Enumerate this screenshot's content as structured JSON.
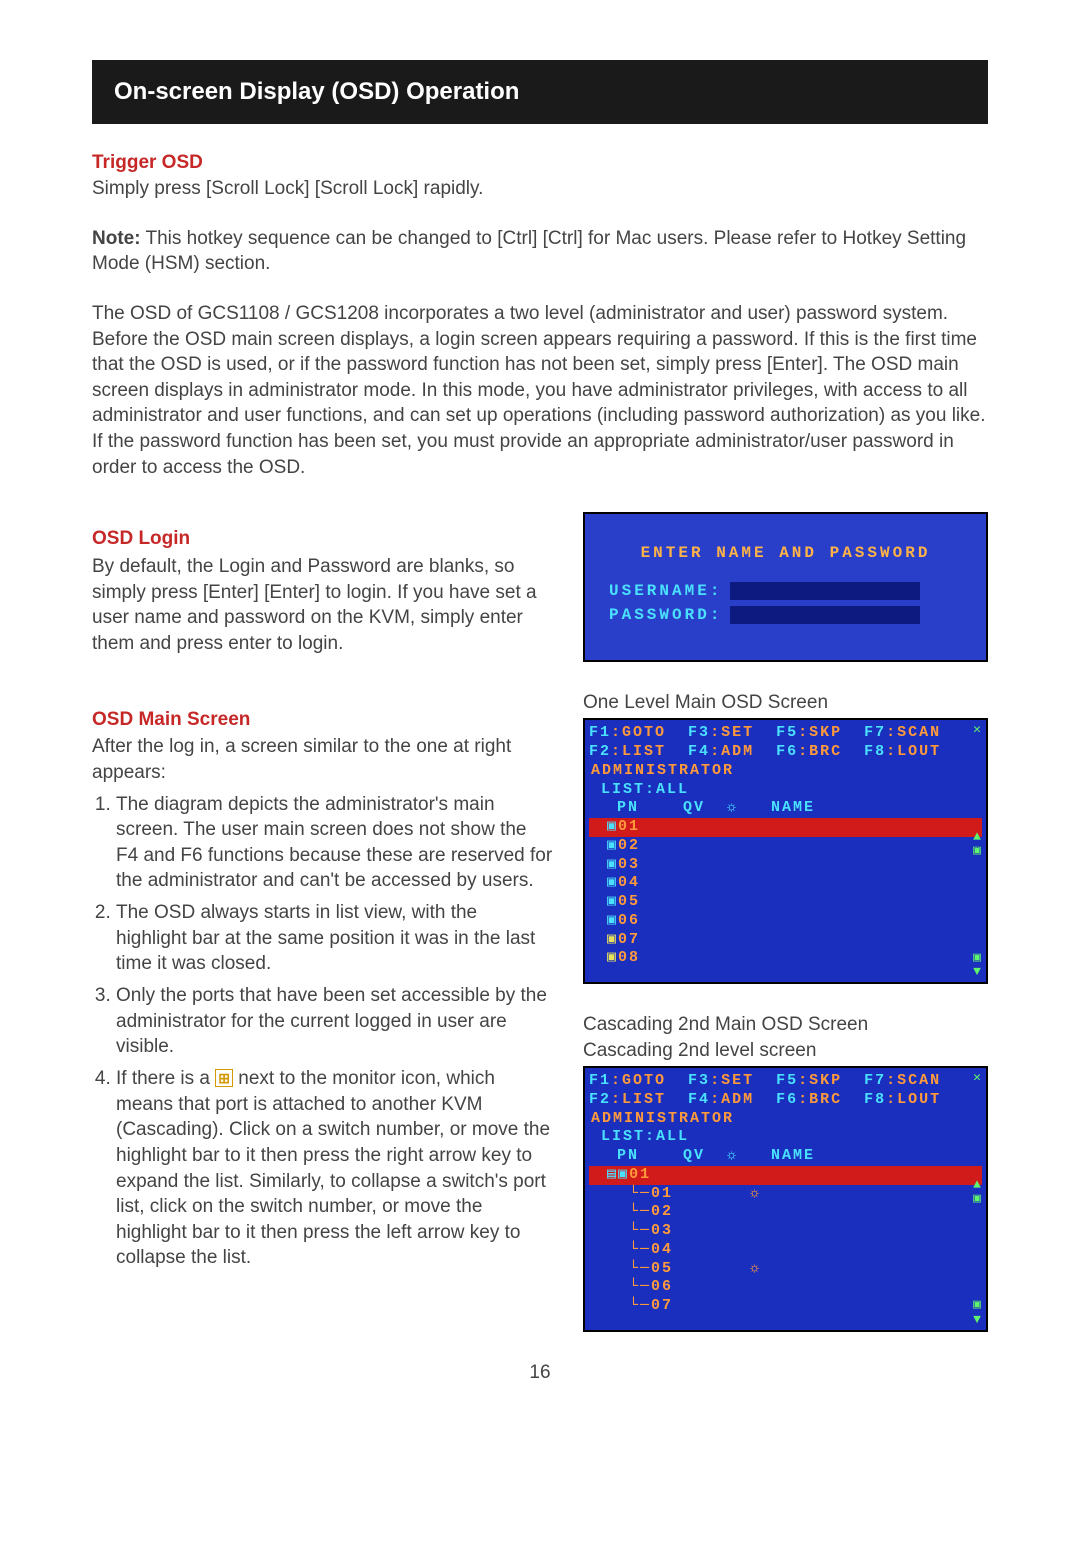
{
  "title": "On-screen Display (OSD) Operation",
  "trigger": {
    "heading": "Trigger OSD",
    "text": "Simply press [Scroll Lock] [Scroll Lock] rapidly."
  },
  "note": {
    "label": "Note:",
    "text": " This hotkey sequence can be changed to [Ctrl] [Ctrl] for Mac users. Please refer to Hotkey Setting Mode (HSM) section."
  },
  "intro_para": "The OSD of GCS1108 / GCS1208 incorporates a two level (administrator and user) password system. Before the OSD main screen displays, a login screen appears requiring a password. If this is the first time that the OSD is used, or if the password function has not been set, simply press [Enter]. The OSD main screen displays in administrator mode. In this mode, you have administrator privileges, with access to all administrator and user functions, and can set up operations (including password authorization) as you like. If the password function has been set, you must provide an appropriate administrator/user password in order to access the OSD.",
  "login": {
    "heading": "OSD Login",
    "text": "By default, the Login and Password are blanks, so simply press [Enter] [Enter] to login. If you have set a user name and password on the KVM, simply enter them and press enter to login.",
    "screen_title": "ENTER NAME AND PASSWORD",
    "username_label": "USERNAME:",
    "password_label": "PASSWORD:"
  },
  "main_screen": {
    "heading": "OSD Main Screen",
    "intro": "After the log in, a screen similar to the one at right  appears:",
    "list": [
      "The diagram depicts the administrator's main screen. The user main screen does not show the F4 and F6 functions because these are reserved for the administrator and can't be accessed by users.",
      "The OSD always starts in list view, with the highlight bar at the same position it was in the last time it was closed.",
      "Only the ports that have been set accessible by the administrator for the current logged in user are visible.",
      "If there is a ⊞ next to the monitor icon, which means that port is attached to another KVM (Cascading). Click on a switch number, or move the highlight bar to it then press the right arrow key to expand the list. Similarly, to collapse a switch's port list, click on the switch number, or move the highlight bar to it then press the left arrow key to collapse the list."
    ]
  },
  "osd1": {
    "caption": "One Level Main OSD Screen",
    "fn1": {
      "k1": "F1",
      "v1": ":GOTO",
      "k2": "F3",
      "v2": ":SET",
      "k3": "F5",
      "v3": ":SKP",
      "k4": "F7",
      "v4": ":SCAN"
    },
    "fn2": {
      "k1": "F2",
      "v1": ":LIST",
      "k2": "F4",
      "v2": ":ADM",
      "k3": "F6",
      "v3": ":BRC",
      "k4": "F8",
      "v4": ":LOUT"
    },
    "admin": "ADMINISTRATOR",
    "list": "LIST:ALL",
    "cols": "PN    QV  ☼   NAME",
    "highlight_icon": "▣",
    "highlight": "01",
    "ports": [
      "02",
      "03",
      "04",
      "05",
      "06",
      "07",
      "08"
    ]
  },
  "osd2": {
    "caption1": "Cascading 2nd Main OSD Screen",
    "caption2": "Cascading 2nd level screen",
    "fn1": {
      "k1": "F1",
      "v1": ":GOTO",
      "k2": "F3",
      "v2": ":SET",
      "k3": "F5",
      "v3": ":SKP",
      "k4": "F7",
      "v4": ":SCAN"
    },
    "fn2": {
      "k1": "F2",
      "v1": ":LIST",
      "k2": "F4",
      "v2": ":ADM",
      "k3": "F6",
      "v3": ":BRC",
      "k4": "F8",
      "v4": ":LOUT"
    },
    "admin": "ADMINISTRATOR",
    "list": "LIST:ALL",
    "cols": "PN    QV  ☼   NAME",
    "highlight_icon": "▤▣",
    "highlight": "01",
    "ports": [
      {
        "n": "01",
        "sun": "☼"
      },
      {
        "n": "02",
        "sun": ""
      },
      {
        "n": "03",
        "sun": ""
      },
      {
        "n": "04",
        "sun": ""
      },
      {
        "n": "05",
        "sun": "☼"
      },
      {
        "n": "06",
        "sun": ""
      },
      {
        "n": "07",
        "sun": ""
      }
    ]
  },
  "page_number": "16"
}
